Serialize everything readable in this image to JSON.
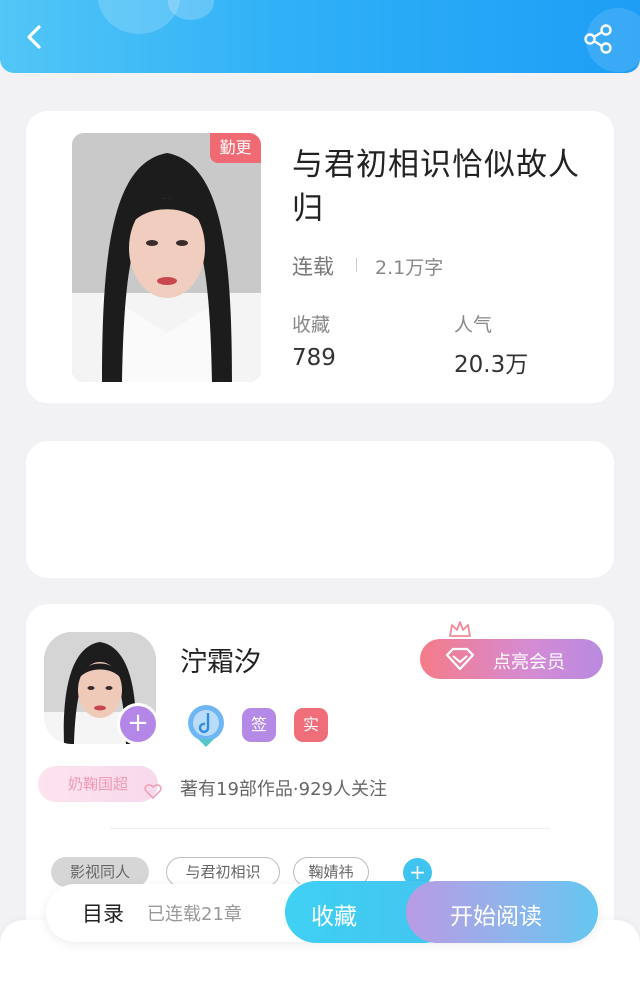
{
  "book": {
    "title": "与君初相识恰似故人归",
    "status": "连载",
    "word_count": "2.1万字",
    "update_badge": "勤更",
    "stats": [
      {
        "label": "收藏",
        "value": "789"
      },
      {
        "label": "人气",
        "value": "20.3万"
      }
    ]
  },
  "author": {
    "name": "泞霜汐",
    "vip_button": "点亮会员",
    "badges": [
      "签",
      "实"
    ],
    "fan_badge": "奶鞠国超",
    "info": "著有19部作品·929人关注"
  },
  "tags": [
    "影视同人",
    "与君初相识",
    "鞠婧祎"
  ],
  "bottom_bar": {
    "catalog_label": "目录",
    "chapter_progress": "已连载21章",
    "favorite_label": "收藏",
    "read_label": "开始阅读"
  },
  "colors": {
    "header_start": "#52c6f6",
    "header_end": "#1e9ef5",
    "update_badge": "#f06a74",
    "author_plus": "#b486e8",
    "favorite_button": "#3fd0f2"
  },
  "icons": {
    "back": "chevron-left-icon",
    "share": "share-icon",
    "vip": "diamond-icon",
    "crown": "crown-icon",
    "author_level": "music-medal-icon"
  }
}
